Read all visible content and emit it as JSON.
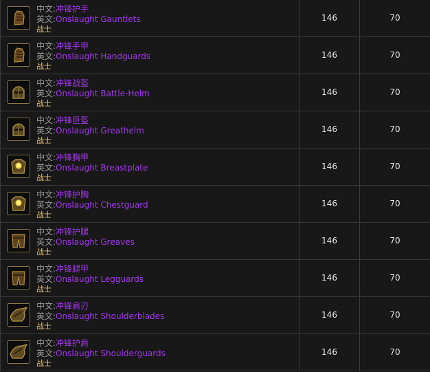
{
  "labels": {
    "cn_prefix": "中文:",
    "en_prefix": "英文:"
  },
  "items": [
    {
      "cn": "冲锋护手",
      "en": "Onslaught Gauntlets",
      "cls": "战士",
      "level": "146",
      "req": "70",
      "icon": "gauntlets-icon"
    },
    {
      "cn": "冲锋手甲",
      "en": "Onslaught Handguards",
      "cls": "战士",
      "level": "146",
      "req": "70",
      "icon": "gauntlets-icon"
    },
    {
      "cn": "冲锋战盔",
      "en": "Onslaught Battle-Helm",
      "cls": "战士",
      "level": "146",
      "req": "70",
      "icon": "helm-icon"
    },
    {
      "cn": "冲锋巨盔",
      "en": "Onslaught Greathelm",
      "cls": "战士",
      "level": "146",
      "req": "70",
      "icon": "helm-icon"
    },
    {
      "cn": "冲锋胸甲",
      "en": "Onslaught Breastplate",
      "cls": "战士",
      "level": "146",
      "req": "70",
      "icon": "chest-icon"
    },
    {
      "cn": "冲锋护胸",
      "en": "Onslaught Chestguard",
      "cls": "战士",
      "level": "146",
      "req": "70",
      "icon": "chest-icon"
    },
    {
      "cn": "冲锋护腿",
      "en": "Onslaught Greaves",
      "cls": "战士",
      "level": "146",
      "req": "70",
      "icon": "legs-icon"
    },
    {
      "cn": "冲锋腿甲",
      "en": "Onslaught Legguards",
      "cls": "战士",
      "level": "146",
      "req": "70",
      "icon": "legs-icon"
    },
    {
      "cn": "冲锋肩刃",
      "en": "Onslaught Shoulderblades",
      "cls": "战士",
      "level": "146",
      "req": "70",
      "icon": "shoulder-icon"
    },
    {
      "cn": "冲锋护肩",
      "en": "Onslaught Shoulderguards",
      "cls": "战士",
      "level": "146",
      "req": "70",
      "icon": "shoulder-icon"
    }
  ]
}
